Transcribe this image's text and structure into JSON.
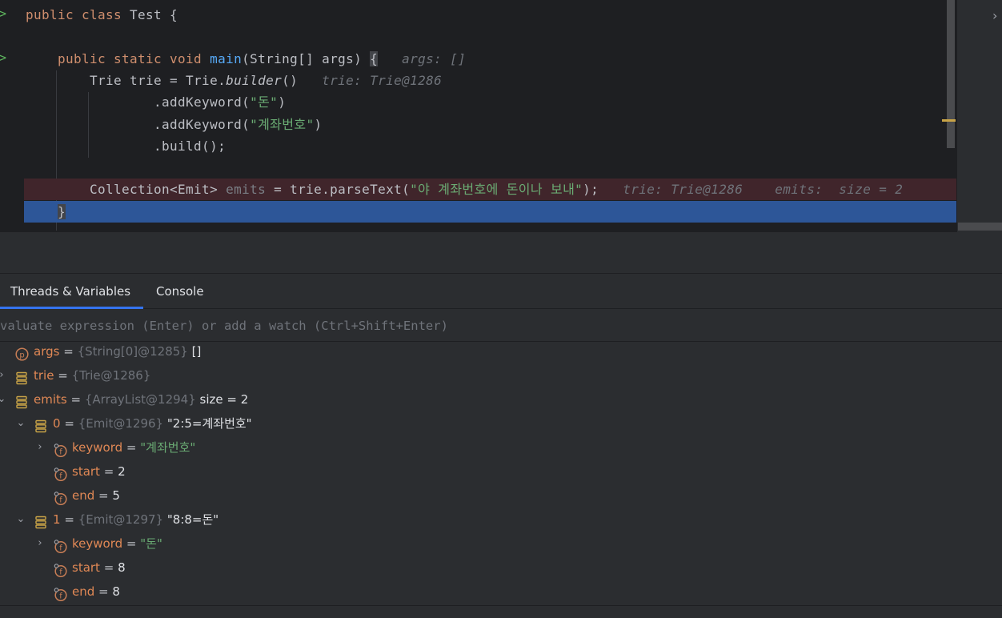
{
  "editor": {
    "lines": [
      {
        "tokens": [
          {
            "t": "public class ",
            "c": "kw"
          },
          {
            "t": "Test {",
            "c": ""
          }
        ],
        "run": true
      },
      {
        "tokens": []
      },
      {
        "tokens": [
          {
            "t": "    public static void ",
            "c": "kw"
          },
          {
            "t": "main",
            "c": "fn"
          },
          {
            "t": "(String[] args) ",
            "c": ""
          },
          {
            "t": "{",
            "c": "brk"
          },
          {
            "t": "   args: []",
            "c": "hint"
          }
        ],
        "run": true
      },
      {
        "tokens": [
          {
            "t": "        Trie trie = Trie.",
            "c": ""
          },
          {
            "t": "builder",
            "c": "it"
          },
          {
            "t": "()",
            "c": ""
          },
          {
            "t": "   trie: Trie@1286",
            "c": "hint"
          }
        ]
      },
      {
        "tokens": [
          {
            "t": "                .addKeyword(",
            "c": ""
          },
          {
            "t": "\"돈\"",
            "c": "str"
          },
          {
            "t": ")",
            "c": ""
          }
        ]
      },
      {
        "tokens": [
          {
            "t": "                .addKeyword(",
            "c": ""
          },
          {
            "t": "\"계좌번호\"",
            "c": "str"
          },
          {
            "t": ")",
            "c": ""
          }
        ]
      },
      {
        "tokens": [
          {
            "t": "                .build();",
            "c": ""
          }
        ]
      },
      {
        "tokens": []
      },
      {
        "tokens": [
          {
            "t": "        Collection<Emit> ",
            "c": ""
          },
          {
            "t": "emits",
            "c": "dim"
          },
          {
            "t": " = trie.parseText(",
            "c": ""
          },
          {
            "t": "\"야 계좌번호에 돈이나 보내\"",
            "c": "str"
          },
          {
            "t": ");",
            "c": ""
          },
          {
            "t": "   trie: Trie@1286    emits:  size = 2",
            "c": "hint"
          }
        ],
        "state": "err"
      },
      {
        "tokens": [
          {
            "t": "    ",
            "c": ""
          },
          {
            "t": "}",
            "c": "brk"
          }
        ],
        "state": "cur"
      }
    ]
  },
  "debugger": {
    "tabs": [
      {
        "label": "Threads & Variables",
        "active": true
      },
      {
        "label": "Console",
        "active": false
      }
    ],
    "eval_placeholder": "valuate expression (Enter) or add a watch (Ctrl+Shift+Enter)",
    "variables": [
      {
        "level": 0,
        "arrow": "none",
        "icon": "parameter",
        "name": "args",
        "type": "{String[0]@1285}",
        "value": "[]",
        "vclass": "vl"
      },
      {
        "level": 0,
        "arrow": "collapsed",
        "icon": "variable",
        "name": "trie",
        "type": "{Trie@1286}",
        "value": "",
        "vclass": "vl"
      },
      {
        "level": 0,
        "arrow": "expanded",
        "icon": "variable",
        "name": "emits",
        "type": "{ArrayList@1294}",
        "value": "size = 2",
        "vclass": "vl"
      },
      {
        "level": 1,
        "arrow": "expanded",
        "icon": "variable",
        "name": "0",
        "type": "{Emit@1296}",
        "value": "\"2:5=계좌번호\"",
        "vclass": "vl"
      },
      {
        "level": 2,
        "arrow": "collapsed",
        "icon": "field",
        "name": "keyword",
        "type": "",
        "value": "\"계좌번호\"",
        "vclass": "vs"
      },
      {
        "level": 2,
        "arrow": "none",
        "icon": "field",
        "name": "start",
        "type": "",
        "value": "2",
        "vclass": "vl"
      },
      {
        "level": 2,
        "arrow": "none",
        "icon": "field",
        "name": "end",
        "type": "",
        "value": "5",
        "vclass": "vl"
      },
      {
        "level": 1,
        "arrow": "expanded",
        "icon": "variable",
        "name": "1",
        "type": "{Emit@1297}",
        "value": "\"8:8=돈\"",
        "vclass": "vl"
      },
      {
        "level": 2,
        "arrow": "collapsed",
        "icon": "field",
        "name": "keyword",
        "type": "",
        "value": "\"돈\"",
        "vclass": "vs"
      },
      {
        "level": 2,
        "arrow": "none",
        "icon": "field",
        "name": "start",
        "type": "",
        "value": "8",
        "vclass": "vl"
      },
      {
        "level": 2,
        "arrow": "none",
        "icon": "field",
        "name": "end",
        "type": "",
        "value": "8",
        "vclass": "vl"
      }
    ],
    "equals": "="
  },
  "colors": {
    "accent": "#3574f0",
    "error_line": "#40252b",
    "current_line": "#2d5698",
    "string": "#6aab73",
    "keyword": "#cf8e6d"
  }
}
